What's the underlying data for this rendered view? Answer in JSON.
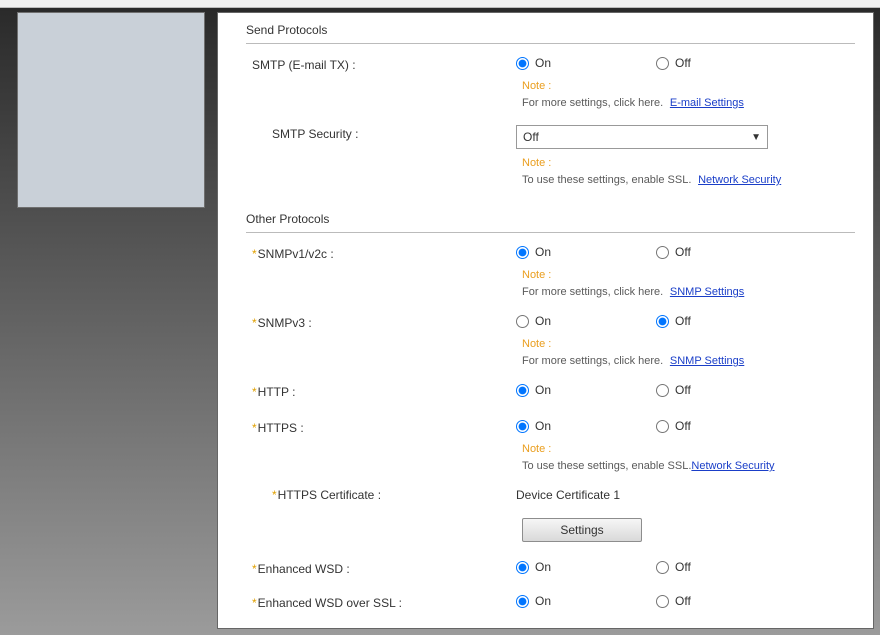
{
  "sections": {
    "send": {
      "title": "Send Protocols"
    },
    "other": {
      "title": "Other Protocols"
    }
  },
  "labels": {
    "smtp": "SMTP (E-mail TX) :",
    "smtp_security": "SMTP Security :",
    "snmpv1": "SNMPv1/v2c :",
    "snmpv3": "SNMPv3 :",
    "http": "HTTP :",
    "https": "HTTPS :",
    "https_cert": "HTTPS Certificate :",
    "ewsd": "Enhanced WSD :",
    "ewsd_ssl": "Enhanced WSD over SSL :"
  },
  "radio": {
    "on": "On",
    "off": "Off"
  },
  "values": {
    "smtp_security_selected": "Off",
    "https_cert_value": "Device Certificate 1"
  },
  "notes": {
    "title": "Note :",
    "more_settings": "For more settings, click here.",
    "enable_ssl_period": "To use these settings, enable SSL.",
    "enable_ssl_nodot": "To use these settings, enable SSL."
  },
  "links": {
    "email": "E-mail Settings",
    "netsec": "Network Security",
    "snmp": "SNMP Settings"
  },
  "buttons": {
    "settings": "Settings"
  }
}
